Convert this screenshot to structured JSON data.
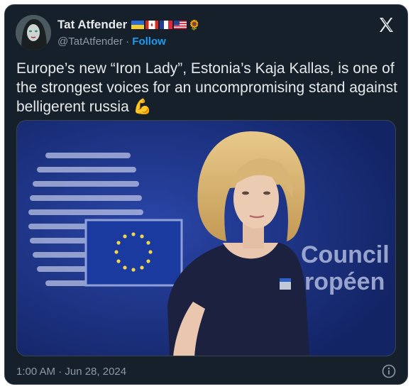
{
  "author": {
    "name": "Tat Atfender",
    "handle": "@TatAtfender",
    "separator": "·",
    "follow_label": "Follow",
    "flags": [
      "flag-ukraine-icon",
      "flag-canada-icon",
      "flag-france-icon",
      "flag-usa-icon"
    ],
    "emoji": "🌻"
  },
  "tweet": {
    "text": "Europe’s new “Iron Lady”, Estonia’s Kaja Kallas, is one of the strongest voices for an uncompromising stand against belligerent russia 💪",
    "timestamp": "1:00 AM · Jun 28, 2024"
  },
  "media": {
    "sign_line1": "Council",
    "sign_line2": "ropéen"
  },
  "colors": {
    "background": "#15202b",
    "text": "#e7e9ea",
    "secondary": "#8b98a5",
    "accent": "#1d9bf0",
    "eu_blue": "#1b2f7a"
  }
}
